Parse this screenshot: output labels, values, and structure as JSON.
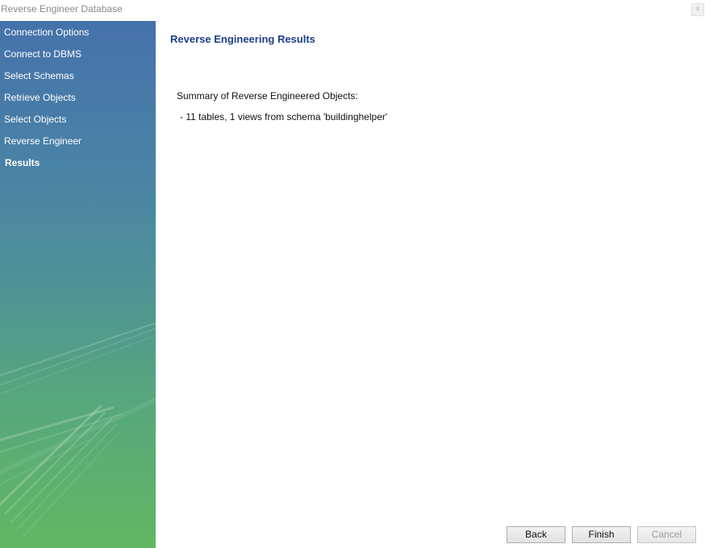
{
  "window": {
    "title": "Reverse Engineer Database",
    "close_glyph": "×"
  },
  "sidebar": {
    "steps": [
      {
        "label": "Connection Options",
        "state": "done"
      },
      {
        "label": "Connect to DBMS",
        "state": "done"
      },
      {
        "label": "Select Schemas",
        "state": "done"
      },
      {
        "label": "Retrieve Objects",
        "state": "done"
      },
      {
        "label": "Select Objects",
        "state": "done"
      },
      {
        "label": "Reverse Engineer",
        "state": "done"
      },
      {
        "label": "Results",
        "state": "active"
      }
    ]
  },
  "main": {
    "title": "Reverse Engineering Results",
    "summary_heading": "Summary of Reverse Engineered Objects:",
    "summary_lines": [
      "- 11 tables, 1 views from schema 'buildinghelper'"
    ]
  },
  "buttons": {
    "back": "Back",
    "finish": "Finish",
    "cancel": "Cancel",
    "cancel_enabled": false
  },
  "colors": {
    "sidebar_top": "#4572ab",
    "sidebar_bottom": "#62b763",
    "title_blue": "#1d3d8a"
  }
}
